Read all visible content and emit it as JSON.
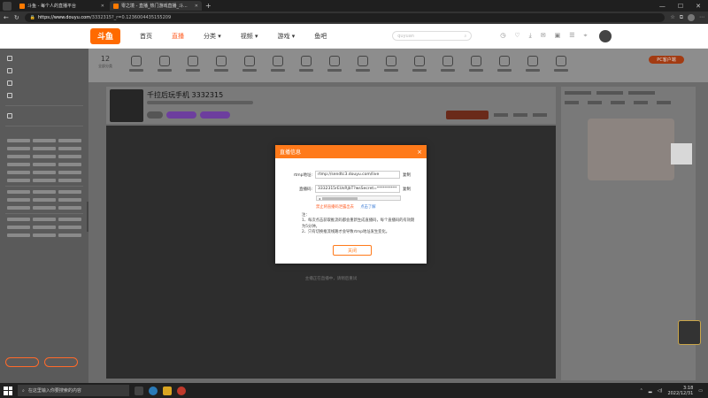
{
  "browser": {
    "tabs": [
      {
        "title": "斗鱼 - 每个人的直播平台",
        "active": false
      },
      {
        "title": "零之境 - 直播_热门游戏直播_斗...",
        "active": true
      }
    ],
    "new_tab": "+",
    "window_controls": [
      "—",
      "☐",
      "✕"
    ],
    "url_host": "https://www.douyu.com",
    "url_path": "/3332315?_r=0.1236004435155209"
  },
  "site": {
    "logo": "斗鱼",
    "nav": [
      {
        "label": "首页",
        "active": false
      },
      {
        "label": "直播",
        "active": true
      },
      {
        "label": "分类 ▾",
        "active": false
      },
      {
        "label": "视频 ▾",
        "active": false
      },
      {
        "label": "游戏 ▾",
        "active": false
      },
      {
        "label": "鱼吧",
        "active": false
      }
    ],
    "search_placeholder": "quyuan"
  },
  "category_bar": {
    "count": "12",
    "count_label": "全部分类",
    "pc_button": "PC客户端"
  },
  "room": {
    "title": "千拉后玩手机 3332315"
  },
  "player": {
    "hint": "主播正在直播中，请稍后重试"
  },
  "modal": {
    "title": "直播信息",
    "close": "×",
    "rtmp_label": "rtmp地址:",
    "rtmp_value": "rtmp://sendtc3.douyu.com/live",
    "key_label": "直播码:",
    "key_value": "3332315rEUsRjbT?wsSecret=**********",
    "copy_label": "复制",
    "warning": "禁止将直播码泄露出去",
    "warning_link": "点击了解",
    "notes": [
      "注：",
      "1、每次点击获取推流码都会重新生成直播码，每个直播码的有效期为5分钟。",
      "2、只有切换推流线路才会导致rtmp地址发生变化。"
    ],
    "button": "关闭"
  },
  "taskbar": {
    "search_placeholder": "在这里输入你要搜索的内容",
    "time": "3:18",
    "date": "2022/12/31"
  },
  "colors": {
    "accent": "#ff7a1a",
    "nav_active": "#ff5d23",
    "link": "#3a7bd5"
  }
}
